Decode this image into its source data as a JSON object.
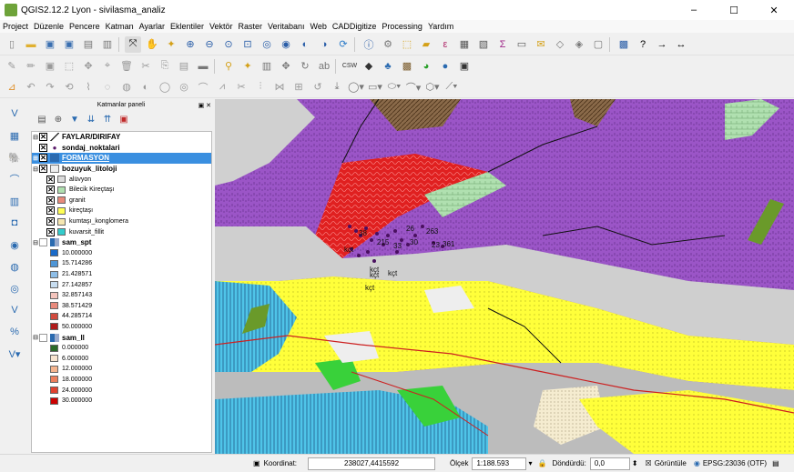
{
  "window": {
    "title": "QGIS2.12.2 Lyon - sivilasma_analiz",
    "min": "–",
    "max": "☐",
    "close": "✕"
  },
  "menu": [
    "Project",
    "Düzenle",
    "Pencere",
    "Katman",
    "Ayarlar",
    "Eklentiler",
    "Vektör",
    "Raster",
    "Veritabanı",
    "Web",
    "CADDigitize",
    "Processing",
    "Yardım"
  ],
  "panel": {
    "title": "Katmanlar paneli",
    "close": "✕"
  },
  "layers": {
    "faylar": "FAYLAR/DIRIFAY",
    "sondaj": "sondaj_noktalari",
    "formasyon": "FORMASYON",
    "bozuyuk": "bozuyuk_litoloji",
    "litoloji_items": [
      "alüvyon",
      "Bilecik Kireçtaşı",
      "granit",
      "kireçtaşı",
      "kumtaşı_konglomera",
      "kuvarsit_fillit"
    ],
    "litoloji_colors": [
      "#dcdcdc",
      "#b0e0b0",
      "#e88a7a",
      "#ffff55",
      "#f5e6b0",
      "#33cccc"
    ],
    "sam_spt": "sam_spt",
    "spt_items": [
      "10.000000",
      "15.714286",
      "21.428571",
      "27.142857",
      "32.857143",
      "38.571429",
      "44.285714",
      "50.000000"
    ],
    "spt_colors": [
      "#1a6ac8",
      "#4f96d6",
      "#8dbde6",
      "#c7ddf0",
      "#f4c4bc",
      "#e88a7c",
      "#d14a3e",
      "#b01c1c"
    ],
    "sam_ll": "sam_ll",
    "ll_items": [
      "0.000000",
      "6.000000",
      "12.000000",
      "18.000000",
      "24.000000",
      "30.000000"
    ],
    "ll_colors": [
      "#2a6b2a",
      "#f7e4d0",
      "#f4b48e",
      "#ec7e5c",
      "#e0412f",
      "#cc0000"
    ]
  },
  "map_labels": {
    "kct1": "kçt",
    "kct2": "kçt",
    "kct3": "kçt",
    "kct4": "kçt",
    "kct5": "kçt",
    "n26": "26",
    "n33": "33",
    "n23": "23",
    "n30": "30",
    "n215": "215",
    "n361": "361",
    "n38": "38",
    "n263": "263"
  },
  "status": {
    "coord_label": "Koordinat:",
    "coord_value": "238027,4415592",
    "scale_label": "Ölçek",
    "scale_value": "1:188.593",
    "rot_label": "Döndürdü:",
    "rot_value": "0,0",
    "render_label": "Görüntüle",
    "crs": "EPSG:23036 (OTF)"
  }
}
